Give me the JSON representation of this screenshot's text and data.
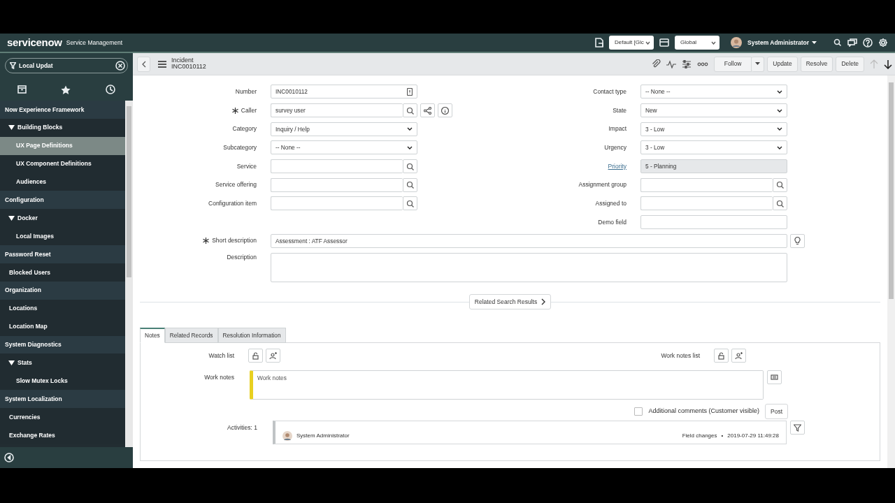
{
  "header": {
    "logo": "servicenow",
    "product": "Service Management",
    "update_set": "Default [Glc",
    "scope": "Global",
    "user": "System Administrator"
  },
  "navigator": {
    "filter": "Local Updat",
    "items": [
      {
        "label": "Now Experience Framework",
        "children": [
          {
            "label": "Building Blocks",
            "expanded": true,
            "selected": false,
            "children": [
              {
                "label": "UX Page Definitions",
                "selected": true
              },
              {
                "label": "UX Component Definitions",
                "selected": false
              },
              {
                "label": "Audiences",
                "selected": false
              }
            ]
          }
        ]
      },
      {
        "label": "Configuration",
        "children": [
          {
            "label": "Docker",
            "expanded": true,
            "selected": false,
            "children": [
              {
                "label": "Local Images",
                "selected": false
              }
            ]
          }
        ]
      },
      {
        "label": "Password Reset",
        "children": [
          {
            "label": "Blocked Users",
            "selected": false
          }
        ]
      },
      {
        "label": "Organization",
        "children": [
          {
            "label": "Locations",
            "selected": false
          },
          {
            "label": "Location Map",
            "selected": false
          }
        ]
      },
      {
        "label": "System Diagnostics",
        "children": [
          {
            "label": "Stats",
            "expanded": true,
            "selected": false,
            "children": [
              {
                "label": "Slow Mutex Locks",
                "selected": false
              }
            ]
          }
        ]
      },
      {
        "label": "System Localization",
        "children": [
          {
            "label": "Currencies",
            "selected": false
          },
          {
            "label": "Exchange Rates",
            "selected": false
          }
        ]
      }
    ]
  },
  "record": {
    "table": "Incident",
    "number": "INC0010112"
  },
  "actions": [
    {
      "label": "Follow",
      "kind": "split"
    },
    {
      "label": "Update",
      "kind": "plain"
    },
    {
      "label": "Resolve",
      "kind": "plain"
    },
    {
      "label": "Delete",
      "kind": "plain"
    }
  ],
  "form": {
    "rows": [
      {
        "left": {
          "label": "Number",
          "value": "INC0010112",
          "kind": "number",
          "mandatory": false
        },
        "right": {
          "label": "Contact type",
          "value": "-- None --",
          "kind": "select"
        }
      },
      {
        "left": {
          "label": "Caller",
          "value": "survey user",
          "kind": "caller",
          "mandatory": true
        },
        "right": {
          "label": "State",
          "value": "New",
          "kind": "select"
        }
      },
      {
        "left": {
          "label": "Category",
          "value": "Inquiry / Help",
          "kind": "select",
          "mandatory": false
        },
        "right": {
          "label": "Impact",
          "value": "3 - Low",
          "kind": "select"
        }
      },
      {
        "left": {
          "label": "Subcategory",
          "value": "-- None --",
          "kind": "select",
          "mandatory": false
        },
        "right": {
          "label": "Urgency",
          "value": "3 - Low",
          "kind": "select"
        }
      },
      {
        "left": {
          "label": "Service",
          "kind": "reference",
          "mandatory": false
        },
        "right": {
          "label": "Priority",
          "value": "5 - Planning",
          "kind": "readonly"
        }
      },
      {
        "left": {
          "label": "Service offering",
          "kind": "reference",
          "mandatory": false
        },
        "right": {
          "label": "Assignment group",
          "kind": "reference"
        }
      },
      {
        "left": {
          "label": "Configuration item",
          "kind": "reference",
          "mandatory": false
        },
        "right": {
          "label": "Assigned to",
          "kind": "reference"
        }
      },
      {
        "right": {
          "label": "Demo field",
          "kind": "text"
        }
      }
    ],
    "short_description": {
      "label": "Short description",
      "value": "Assessment :  ATF Assessor",
      "mandatory": true
    },
    "description": {
      "label": "Description"
    }
  },
  "related_search": "Related Search Results",
  "tabs": [
    {
      "label": "Notes",
      "selected": true
    },
    {
      "label": "Related Records",
      "selected": false
    },
    {
      "label": "Resolution Information",
      "selected": false
    }
  ],
  "notes": {
    "watch_list": "Watch list",
    "work_notes_list": "Work notes list",
    "work_notes_label": "Work notes",
    "work_notes_placeholder": "Work notes",
    "additional_comments": {
      "label": "Additional comments (Customer visible)",
      "checked": false
    },
    "post": "Post",
    "activities": "Activities: 1",
    "activity": {
      "user": "System Administrator",
      "kind": "Field changes",
      "separator": "•",
      "time": "2019-07-29 11:49:28"
    }
  }
}
